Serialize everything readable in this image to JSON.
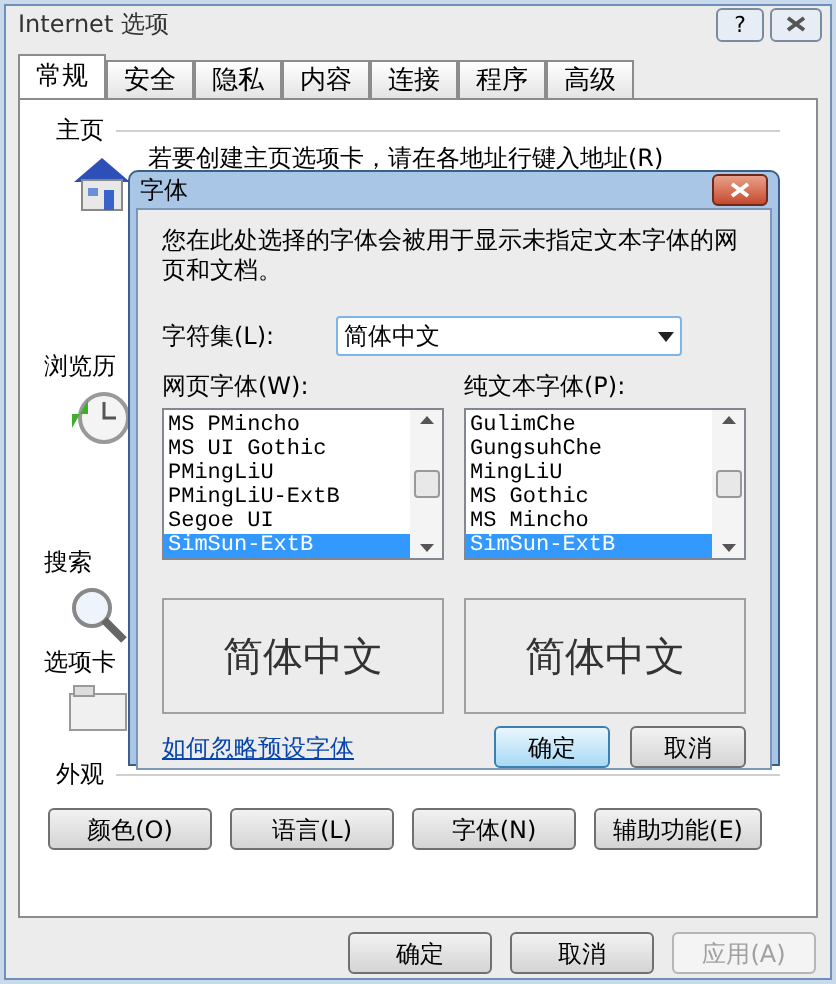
{
  "window": {
    "title": "Internet 选项",
    "help_button": "?"
  },
  "tabs": [
    {
      "label": "常规",
      "selected": true
    },
    {
      "label": "安全",
      "selected": false
    },
    {
      "label": "隐私",
      "selected": false
    },
    {
      "label": "内容",
      "selected": false
    },
    {
      "label": "连接",
      "selected": false
    },
    {
      "label": "程序",
      "selected": false
    },
    {
      "label": "高级",
      "selected": false
    }
  ],
  "sections": [
    {
      "kind": "home",
      "title": "主页",
      "text": "若要创建主页选项卡，请在各地址行键入地址(R)"
    },
    {
      "kind": "history",
      "title": "浏览历"
    },
    {
      "kind": "search",
      "title": "搜索"
    },
    {
      "kind": "tabs",
      "title": "选项卡"
    },
    {
      "kind": "appearance",
      "title": "外观",
      "buttons": [
        "颜色(O)",
        "语言(L)",
        "字体(N)",
        "辅助功能(E)"
      ]
    }
  ],
  "buttons": [
    {
      "label": "确定",
      "disabled": false
    },
    {
      "label": "取消",
      "disabled": false
    },
    {
      "label": "应用(A)",
      "disabled": true
    }
  ],
  "dialog": {
    "title": "字体",
    "description": "您在此处选择的字体会被用于显示未指定文本字体的网页和文档。",
    "charset_label": "字符集(L):",
    "charset_value": "简体中文",
    "lists": [
      {
        "label": "网页字体(W):",
        "preview": "简体中文",
        "items": [
          {
            "name": "MS PMincho",
            "selected": false
          },
          {
            "name": "MS UI Gothic",
            "selected": false
          },
          {
            "name": "PMingLiU",
            "selected": false
          },
          {
            "name": "PMingLiU-ExtB",
            "selected": false
          },
          {
            "name": "Segoe UI",
            "selected": false
          },
          {
            "name": "SimSun-ExtB",
            "selected": true
          }
        ]
      },
      {
        "label": "纯文本字体(P):",
        "preview": "简体中文",
        "items": [
          {
            "name": "GulimChe",
            "selected": false
          },
          {
            "name": "GungsuhChe",
            "selected": false
          },
          {
            "name": "MingLiU",
            "selected": false
          },
          {
            "name": "MS Gothic",
            "selected": false
          },
          {
            "name": "MS Mincho",
            "selected": false
          },
          {
            "name": "SimSun-ExtB",
            "selected": true
          }
        ]
      }
    ],
    "link": "如何忽略预设字体",
    "buttons": [
      {
        "label": "确定",
        "default": true
      },
      {
        "label": "取消",
        "default": false
      }
    ]
  }
}
